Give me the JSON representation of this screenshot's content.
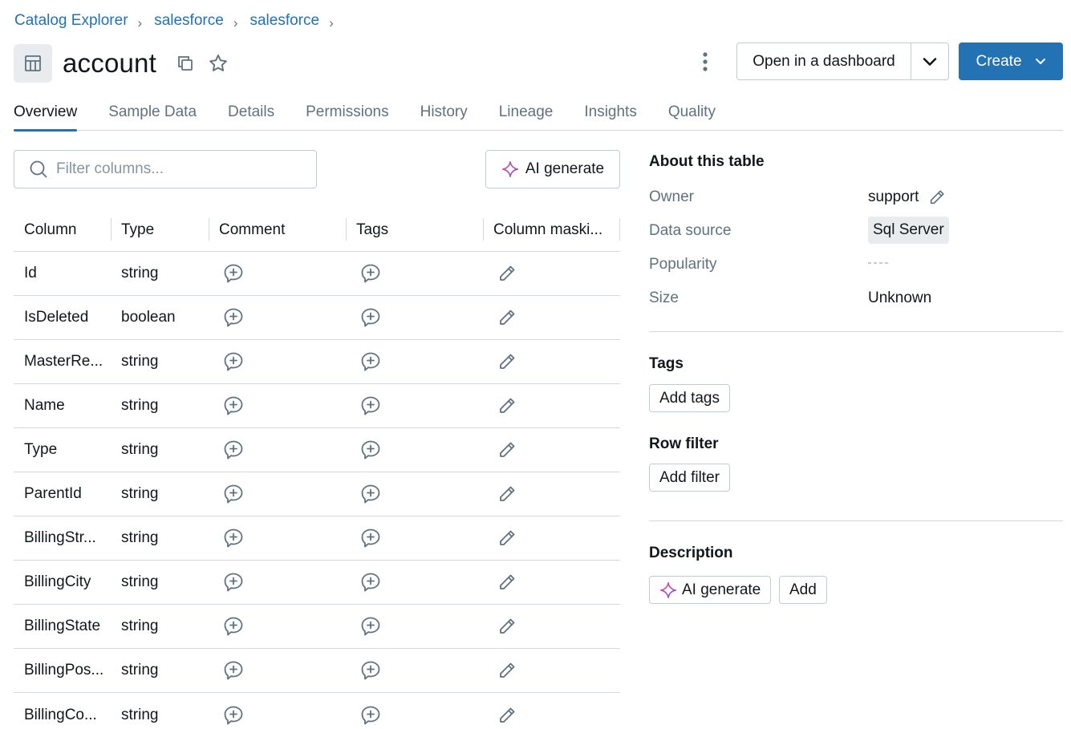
{
  "breadcrumb": [
    "Catalog Explorer",
    "salesforce",
    "salesforce"
  ],
  "title": "account",
  "header": {
    "open_dashboard_label": "Open in a dashboard",
    "create_label": "Create"
  },
  "tabs": [
    "Overview",
    "Sample Data",
    "Details",
    "Permissions",
    "History",
    "Lineage",
    "Insights",
    "Quality"
  ],
  "active_tab": "Overview",
  "filter": {
    "placeholder": "Filter columns..."
  },
  "ai_generate_label": "AI generate",
  "columns_table": {
    "headers": [
      "Column",
      "Type",
      "Comment",
      "Tags",
      "Column maski..."
    ],
    "rows": [
      {
        "name": "Id",
        "type": "string"
      },
      {
        "name": "IsDeleted",
        "type": "boolean"
      },
      {
        "name": "MasterRe...",
        "type": "string"
      },
      {
        "name": "Name",
        "type": "string"
      },
      {
        "name": "Type",
        "type": "string"
      },
      {
        "name": "ParentId",
        "type": "string"
      },
      {
        "name": "BillingStr...",
        "type": "string"
      },
      {
        "name": "BillingCity",
        "type": "string"
      },
      {
        "name": "BillingState",
        "type": "string"
      },
      {
        "name": "BillingPos...",
        "type": "string"
      },
      {
        "name": "BillingCo...",
        "type": "string"
      }
    ]
  },
  "about": {
    "heading": "About this table",
    "owner_label": "Owner",
    "owner_value": "support",
    "data_source_label": "Data source",
    "data_source_value": "Sql Server",
    "popularity_label": "Popularity",
    "size_label": "Size",
    "size_value": "Unknown"
  },
  "tags_section": {
    "heading": "Tags",
    "button": "Add tags"
  },
  "row_filter": {
    "heading": "Row filter",
    "button": "Add filter"
  },
  "description": {
    "heading": "Description",
    "ai_button": "AI generate",
    "add_button": "Add"
  },
  "colors": {
    "accent": "#2272b4",
    "border": "#c0cdd8",
    "muted_text": "#5f7281",
    "icon": "#5f7281",
    "ai_sparkle_1": "#e4409b",
    "ai_sparkle_2": "#7c5bd9"
  }
}
